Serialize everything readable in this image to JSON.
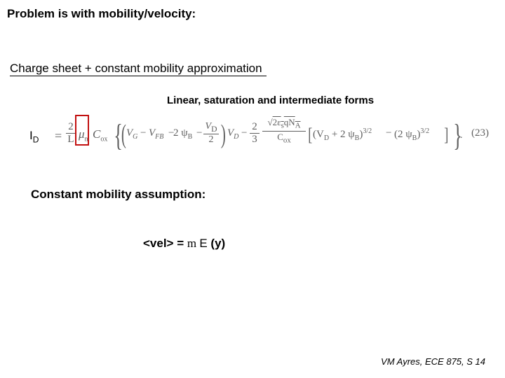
{
  "title": "Problem is with mobility/velocity:",
  "subtitle": "Charge sheet + constant mobility approximation",
  "forms_caption": "Linear, saturation and intermediate forms",
  "id_symbol": "I",
  "id_subscript": "D",
  "equation": {
    "eq": "=",
    "frac1_num": "2",
    "frac1_den": "L",
    "mu": "μ",
    "mu_sub": "n",
    "cox": "C",
    "cox_sub": "ox",
    "vg": "V",
    "vg_sub": "G",
    "minus": "−",
    "vfb": "V",
    "vfb_sub": "FB",
    "two_psi": "2 ψ",
    "psi_sub": "B",
    "vd": "V",
    "vd_sub": "D",
    "frac2_den": "2",
    "frac3_num": "2",
    "frac3_den": "3",
    "frac4_num": "√(2ε_s q N_A)",
    "frac4_den": "C_ox",
    "p1": "(V_D + 2 ψ_B)",
    "p1_exp": "3/2",
    "p2": "(2 ψ_B)",
    "p2_exp": "3/2",
    "dot": ".",
    "eqnum": "(23)"
  },
  "assumption": "Constant mobility assumption:",
  "vel_equation": {
    "lhs": "<vel> = ",
    "mu": "m ",
    "efield": "E",
    "arg": " (y)"
  },
  "footer": "VM Ayres, ECE 875, S 14"
}
